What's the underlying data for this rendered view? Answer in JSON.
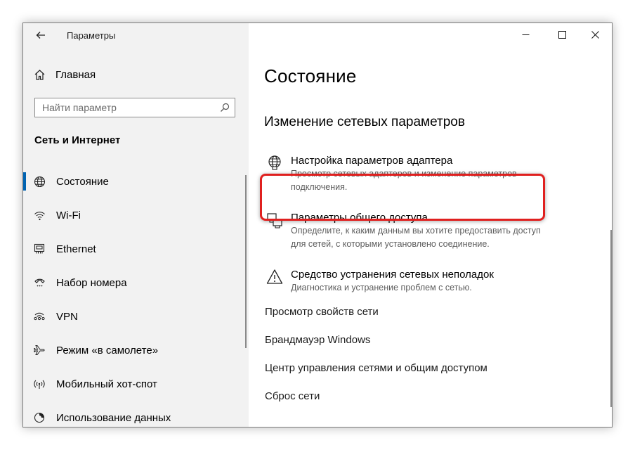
{
  "window": {
    "title": "Параметры"
  },
  "sidebar": {
    "home_label": "Главная",
    "search_placeholder": "Найти параметр",
    "section_title": "Сеть и Интернет",
    "items": [
      {
        "label": "Состояние",
        "icon": "globe-icon",
        "selected": true
      },
      {
        "label": "Wi-Fi",
        "icon": "wifi-icon"
      },
      {
        "label": "Ethernet",
        "icon": "ethernet-icon"
      },
      {
        "label": "Набор номера",
        "icon": "dialup-icon"
      },
      {
        "label": "VPN",
        "icon": "vpn-icon"
      },
      {
        "label": "Режим «в самолете»",
        "icon": "airplane-icon"
      },
      {
        "label": "Мобильный хот-спот",
        "icon": "hotspot-icon"
      },
      {
        "label": "Использование данных",
        "icon": "data-usage-icon"
      }
    ]
  },
  "main": {
    "title": "Состояние",
    "section_title": "Изменение сетевых параметров",
    "options": [
      {
        "title": "Настройка параметров адаптера",
        "desc": "Просмотр сетевых адаптеров и изменение параметров подключения.",
        "icon": "adapter-icon"
      },
      {
        "title": "Параметры общего доступа",
        "desc": "Определите, к каким данным вы хотите предоставить доступ для сетей, с которыми установлено соединение.",
        "icon": "sharing-icon"
      },
      {
        "title": "Средство устранения сетевых неполадок",
        "desc": "Диагностика и устранение проблем с сетью.",
        "icon": "warning-icon"
      }
    ],
    "links": [
      "Просмотр свойств сети",
      "Брандмауэр Windows",
      "Центр управления сетями и общим доступом",
      "Сброс сети"
    ]
  },
  "colors": {
    "accent": "#0063b1",
    "highlight": "#e0201f",
    "sidebar_bg": "#f2f2f2"
  }
}
